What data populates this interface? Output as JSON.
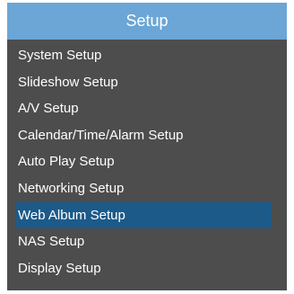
{
  "title": "Setup",
  "menu": {
    "items": [
      {
        "label": "System Setup"
      },
      {
        "label": "Slideshow Setup"
      },
      {
        "label": "A/V Setup"
      },
      {
        "label": "Calendar/Time/Alarm Setup"
      },
      {
        "label": "Auto Play Setup"
      },
      {
        "label": "Networking Setup"
      },
      {
        "label": "Web Album Setup",
        "selected": true
      },
      {
        "label": "NAS Setup"
      },
      {
        "label": "Display Setup"
      }
    ]
  },
  "colors": {
    "title_bar": "#6ba6d6",
    "panel": "#4d4d4d",
    "selection": "#1c5a8a",
    "text": "#ffffff"
  }
}
